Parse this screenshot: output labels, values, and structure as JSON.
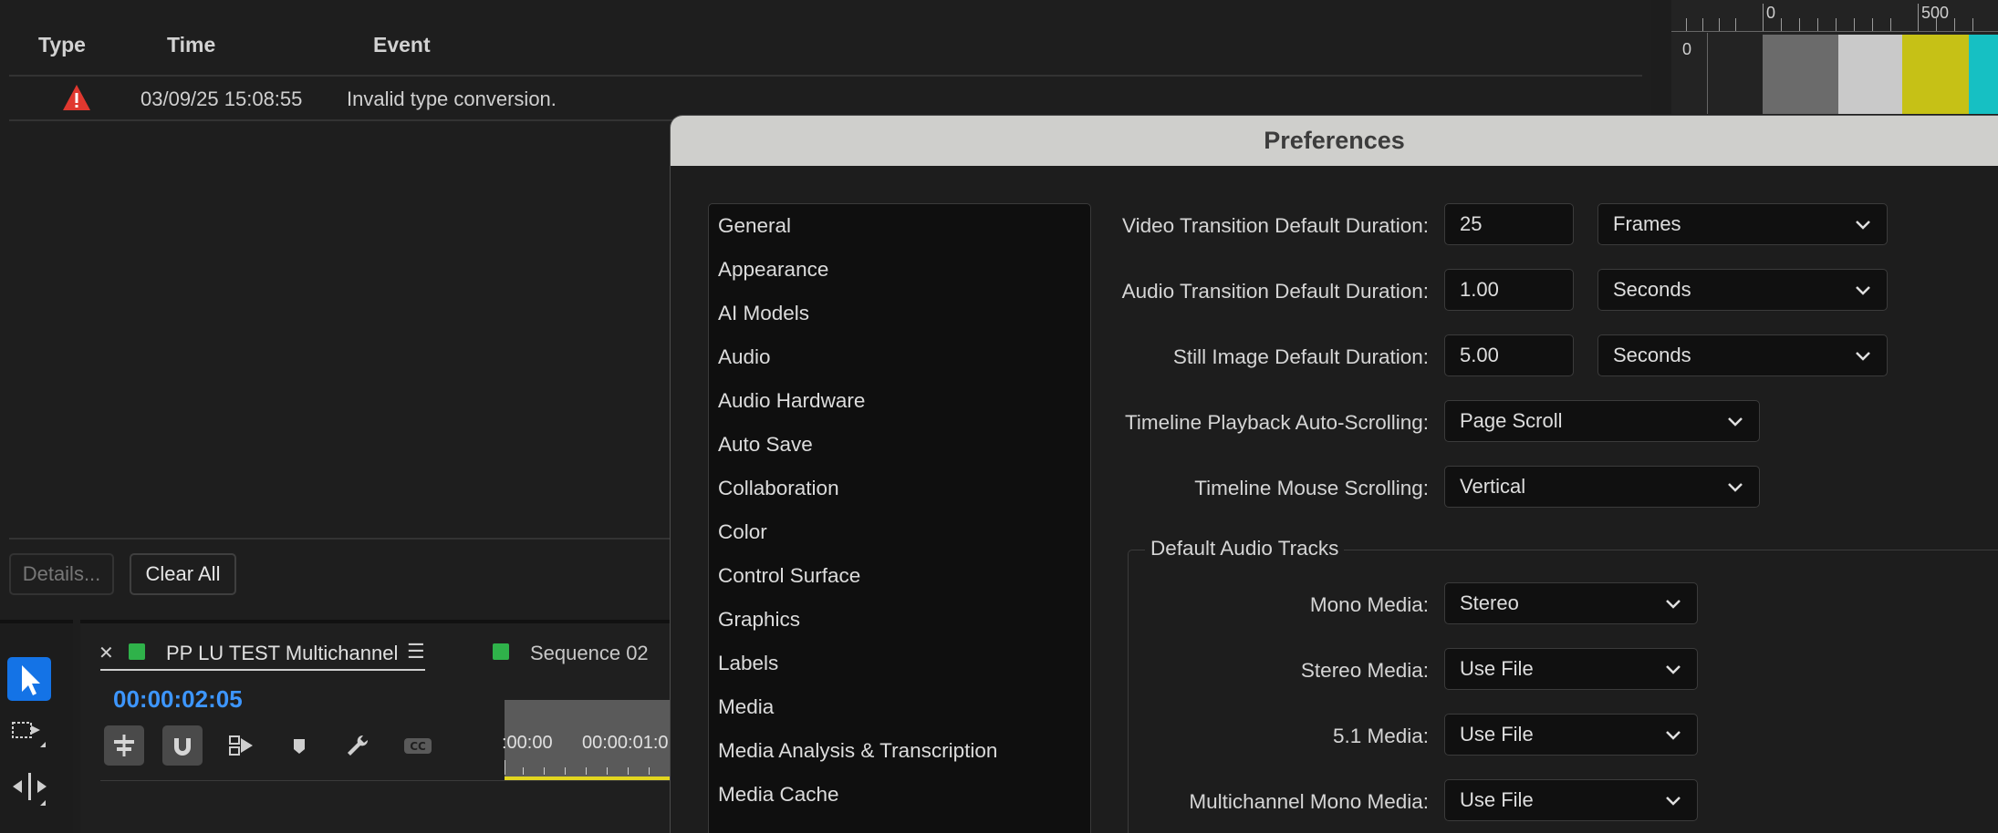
{
  "events": {
    "headers": {
      "type": "Type",
      "time": "Time",
      "event": "Event"
    },
    "rows": [
      {
        "type_icon": "warning-icon",
        "time": "03/09/25 15:08:55",
        "event": "Invalid type conversion."
      }
    ],
    "details_button": "Details...",
    "clear_button": "Clear All"
  },
  "monitor": {
    "ruler_labels": [
      "0",
      "500"
    ],
    "row_label": "0",
    "bars": [
      "#6b6b6b",
      "#c9c9c9",
      "#c6c116",
      "#16c0c3"
    ]
  },
  "timeline": {
    "tab1_label": "PP LU TEST Multichannel",
    "tab2_label": "Sequence 02",
    "timecode": "00:00:02:05",
    "ruler_labels": [
      ":00:00",
      "00:00:01:0"
    ],
    "tab_color": "#2fb24a",
    "timecode_color": "#3d96ff"
  },
  "prefs": {
    "title": "Preferences",
    "categories": [
      "General",
      "Appearance",
      "AI Models",
      "Audio",
      "Audio Hardware",
      "Auto Save",
      "Collaboration",
      "Color",
      "Control Surface",
      "Graphics",
      "Labels",
      "Media",
      "Media Analysis & Transcription",
      "Media Cache"
    ],
    "video_transition": {
      "label": "Video Transition Default Duration:",
      "value": "25",
      "unit": "Frames"
    },
    "audio_transition": {
      "label": "Audio Transition Default Duration:",
      "value": "1.00",
      "unit": "Seconds"
    },
    "still_image": {
      "label": "Still Image Default Duration:",
      "value": "5.00",
      "unit": "Seconds"
    },
    "auto_scroll": {
      "label": "Timeline Playback Auto-Scrolling:",
      "value": "Page Scroll"
    },
    "mouse_scroll": {
      "label": "Timeline Mouse Scrolling:",
      "value": "Vertical"
    },
    "audio_tracks": {
      "title": "Default Audio Tracks",
      "mono": {
        "label": "Mono Media:",
        "value": "Stereo"
      },
      "stereo": {
        "label": "Stereo Media:",
        "value": "Use File"
      },
      "five_one": {
        "label": "5.1 Media:",
        "value": "Use File"
      },
      "multi_mono": {
        "label": "Multichannel Mono Media:",
        "value": "Use File"
      }
    }
  }
}
